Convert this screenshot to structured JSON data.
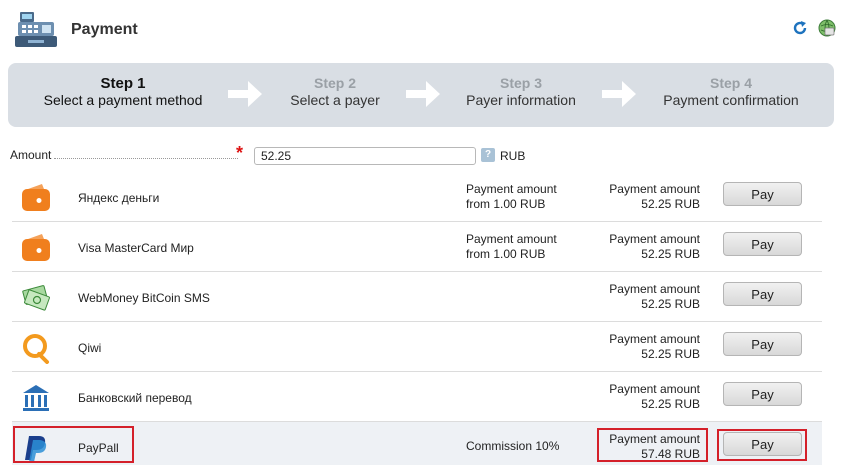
{
  "header": {
    "title": "Payment"
  },
  "steps": [
    {
      "num": "Step 1",
      "label": "Select a payment method"
    },
    {
      "num": "Step 2",
      "label": "Select a payer"
    },
    {
      "num": "Step 3",
      "label": "Payer information"
    },
    {
      "num": "Step 4",
      "label": "Payment confirmation"
    }
  ],
  "amount": {
    "label": "Amount",
    "value": "52.25",
    "currency": "RUB",
    "help": "?",
    "required_mark": "*"
  },
  "methods": [
    {
      "name": "Яндекс деньги",
      "limit_line1": "Payment amount",
      "limit_line2": "from 1.00 RUB",
      "amount_line1": "Payment amount",
      "amount_line2": "52.25 RUB",
      "button": "Pay",
      "icon": "wallet-icon"
    },
    {
      "name": "Visa MasterCard Мир",
      "limit_line1": "Payment amount",
      "limit_line2": "from 1.00 RUB",
      "amount_line1": "Payment amount",
      "amount_line2": "52.25 RUB",
      "button": "Pay",
      "icon": "wallet-icon"
    },
    {
      "name": "WebMoney BitCoin SMS",
      "amount_line1": "Payment amount",
      "amount_line2": "52.25 RUB",
      "button": "Pay",
      "icon": "money-icon"
    },
    {
      "name": "Qiwi",
      "amount_line1": "Payment amount",
      "amount_line2": "52.25 RUB",
      "button": "Pay",
      "icon": "qiwi-icon"
    },
    {
      "name": "Банковский перевод",
      "amount_line1": "Payment amount",
      "amount_line2": "52.25 RUB",
      "button": "Pay",
      "icon": "bank-icon"
    },
    {
      "name": "PayPall",
      "commission": "Commission 10%",
      "amount_line1": "Payment amount",
      "amount_line2": "57.48 RUB",
      "button": "Pay",
      "icon": "paypal-icon"
    }
  ],
  "colors": {
    "accent_orange": "#f07f1e",
    "highlight_red": "#d4202a",
    "steps_bg": "#d9dee4"
  }
}
